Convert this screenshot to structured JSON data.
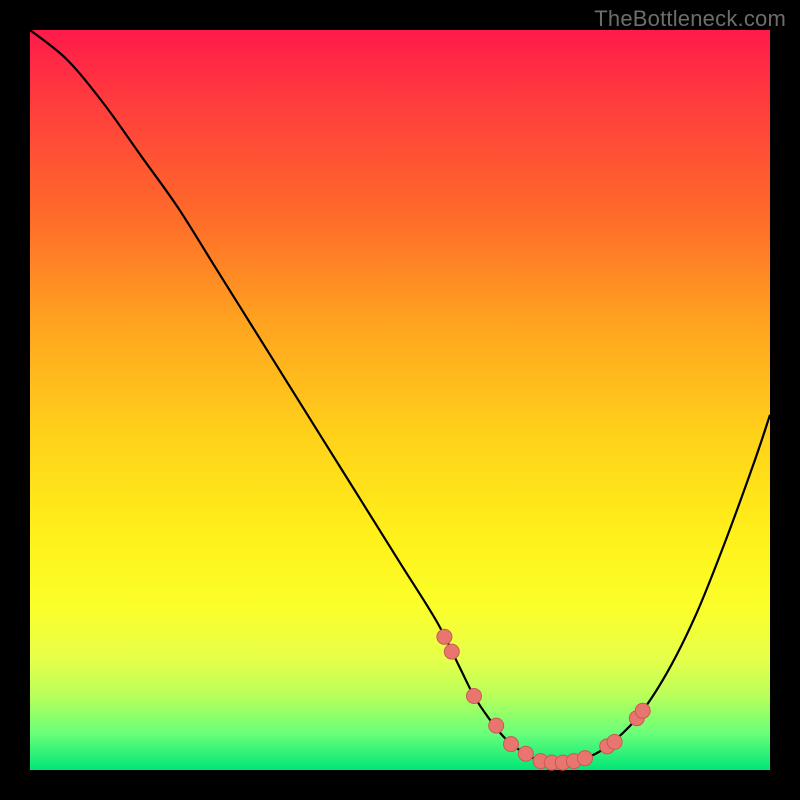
{
  "watermark": "TheBottleneck.com",
  "colors": {
    "curve": "#000000",
    "marker_fill": "#e8766f",
    "marker_stroke": "#c95a53",
    "background_black": "#000000"
  },
  "chart_data": {
    "type": "line",
    "title": "",
    "xlabel": "",
    "ylabel": "",
    "xlim": [
      0,
      100
    ],
    "ylim": [
      0,
      100
    ],
    "grid": false,
    "series": [
      {
        "name": "bottleneck-curve",
        "x": [
          0,
          5,
          10,
          15,
          20,
          25,
          30,
          35,
          40,
          45,
          50,
          55,
          58,
          60,
          62,
          64,
          66,
          68,
          70,
          72,
          75,
          78,
          82,
          86,
          90,
          94,
          98,
          100
        ],
        "y": [
          100,
          96,
          90,
          83,
          76,
          68,
          60,
          52,
          44,
          36,
          28,
          20,
          14,
          10,
          7,
          4.5,
          2.8,
          1.6,
          1,
          1,
          1.6,
          3.2,
          7,
          13,
          21,
          31,
          42,
          48
        ]
      }
    ],
    "markers": {
      "name": "highlight-points",
      "x": [
        56,
        57,
        60,
        63,
        65,
        67,
        69,
        70.5,
        72,
        73.5,
        75,
        78,
        79,
        82,
        82.8
      ],
      "y": [
        18,
        16,
        10,
        6,
        3.5,
        2.2,
        1.2,
        1,
        1,
        1.2,
        1.6,
        3.2,
        3.8,
        7,
        8
      ]
    }
  }
}
